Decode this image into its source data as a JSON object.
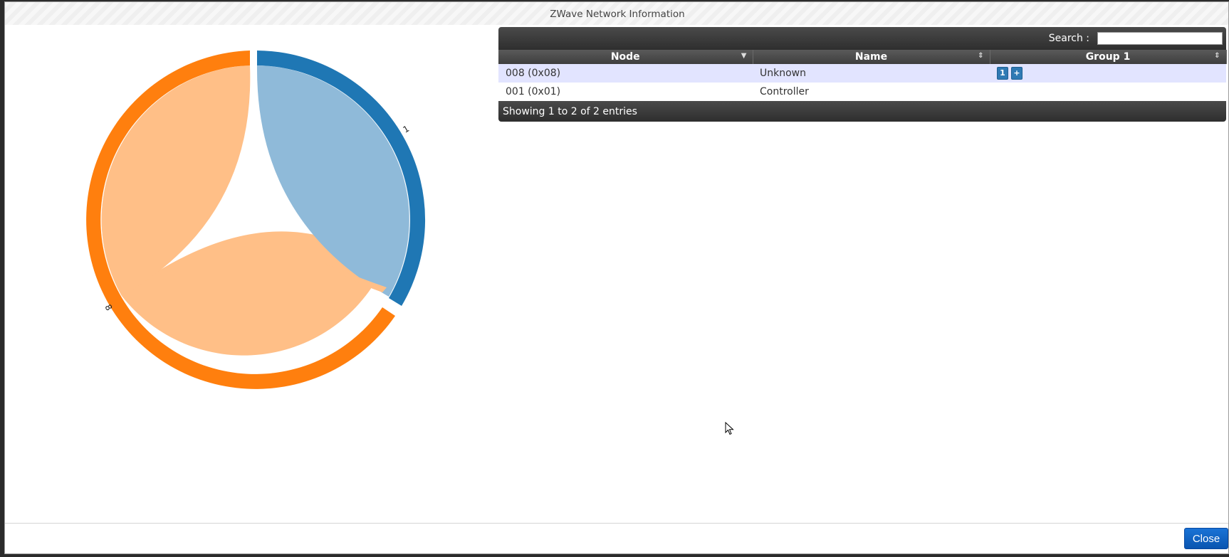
{
  "dialog": {
    "title": "ZWave Network Information",
    "close_label": "Close"
  },
  "chord": {
    "node_labels": [
      "1",
      "8"
    ],
    "colors": {
      "node_1": "#1f77b4",
      "node_1_light": "#8fbad9",
      "node_8": "#ff7f0e",
      "node_8_light": "#ffbf87"
    }
  },
  "table": {
    "search_label": "Search :",
    "search_value": "",
    "columns": [
      "Node",
      "Name",
      "Group 1"
    ],
    "rows": [
      {
        "node": "008 (0x08)",
        "name": "Unknown",
        "group_buttons": [
          "1",
          "+"
        ]
      },
      {
        "node": "001 (0x01)",
        "name": "Controller",
        "group_buttons": []
      }
    ],
    "info": "Showing 1 to 2 of 2 entries"
  }
}
